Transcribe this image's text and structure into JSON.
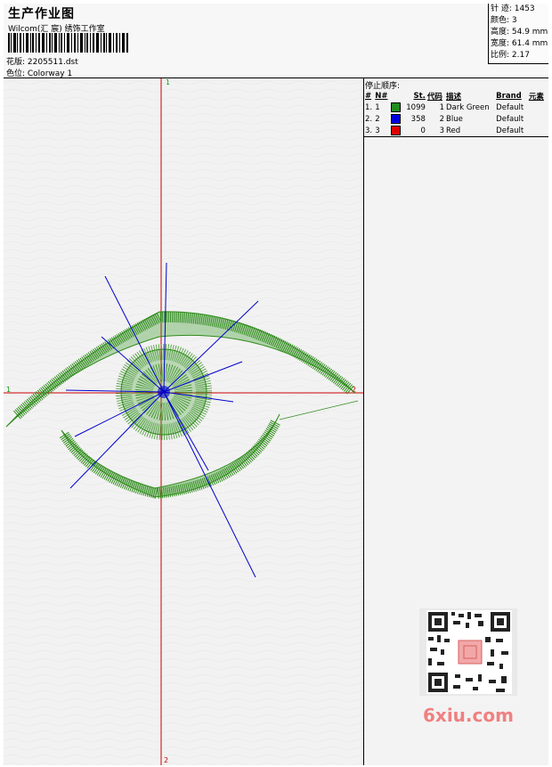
{
  "header": {
    "title": "生产作业图",
    "company": "Wilcom(汇 宸) 绣饰工作室",
    "design_file_label": "花版: 2205511.dst",
    "colorway_label": "色位: Colorway 1"
  },
  "stats": {
    "stitches": "针 迹: 1453",
    "colors": "颜色: 3",
    "height": "高度: 54.9 mm",
    "width": "宽度: 61.4 mm",
    "ratio": "比例: 2.17"
  },
  "canvas": {
    "axis_top": "1",
    "axis_bottom": "2",
    "axis_left": "1",
    "axis_right": "2",
    "colors": {
      "green": "#2e8b1a",
      "blue": "#0000cc",
      "red": "#cc0000"
    }
  },
  "panel": {
    "heading": "停止顺序:",
    "columns": [
      "#",
      "N#",
      "St.",
      "代码",
      "描述",
      "Brand",
      "元素"
    ],
    "rows": [
      {
        "num": "1.",
        "n": "1",
        "color": "#1e8c1e",
        "st": "1099",
        "code": "1",
        "desc": "Dark Green",
        "brand": "Default"
      },
      {
        "num": "2.",
        "n": "2",
        "color": "#0000dd",
        "st": "358",
        "code": "2",
        "desc": "Blue",
        "brand": "Default"
      },
      {
        "num": "3.",
        "n": "3",
        "color": "#dd0000",
        "st": "0",
        "code": "3",
        "desc": "Red",
        "brand": "Default"
      }
    ]
  },
  "watermark": {
    "text": "6xiu.com"
  }
}
